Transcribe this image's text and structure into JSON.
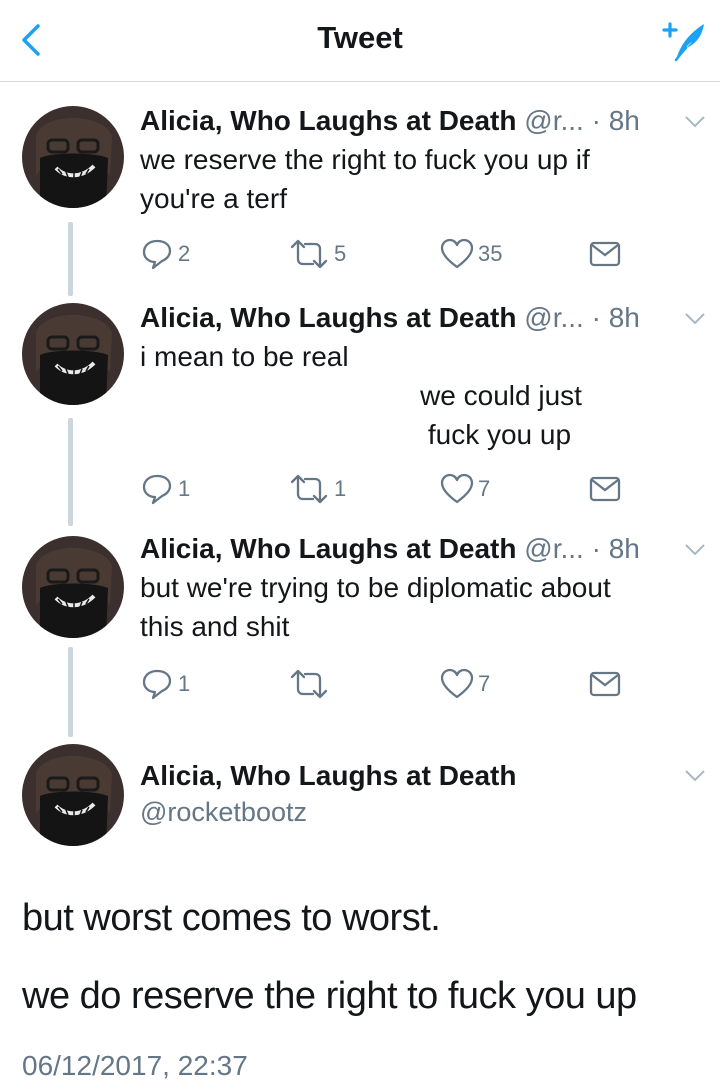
{
  "header": {
    "title": "Tweet",
    "back_icon": "chevron-left-icon",
    "compose_icon": "compose-tweet-icon",
    "accent": "#1da1f2"
  },
  "thread": [
    {
      "name": "Alicia, Who Laughs at Death",
      "handle": "@r...",
      "dot": "·",
      "time": "8h",
      "text": "we reserve the right to fuck you up if\nyou're a terf",
      "replies": "2",
      "retweets": "5",
      "likes": "35"
    },
    {
      "name": "Alicia, Who Laughs at Death",
      "handle": "@r...",
      "dot": "·",
      "time": "8h",
      "text": "i mean to be real\n                                    we could just\n                                     fuck you up",
      "replies": "1",
      "retweets": "1",
      "likes": "7"
    },
    {
      "name": "Alicia, Who Laughs at Death",
      "handle": "@r...",
      "dot": "·",
      "time": "8h",
      "text": "but we're trying to be diplomatic about\nthis and shit",
      "replies": "1",
      "retweets": "",
      "likes": "7"
    }
  ],
  "main_tweet": {
    "name": "Alicia, Who Laughs at Death",
    "handle": "@rocketbootz",
    "line1": "but worst comes to worst.",
    "line2": "we do reserve the right to fuck you up",
    "timestamp": "06/12/2017, 22:37"
  }
}
